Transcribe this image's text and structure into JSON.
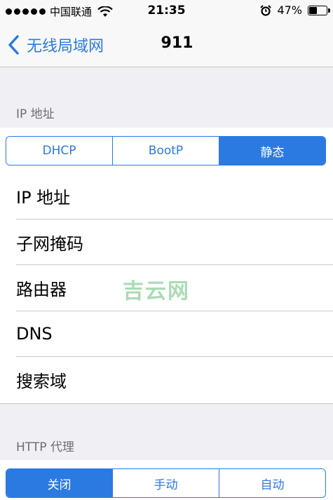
{
  "status_bar": {
    "carrier": "中国联通",
    "time": "21:35",
    "battery_percent": "47%",
    "battery_level": 0.47
  },
  "nav": {
    "back_label": "无线局域网",
    "title": "911"
  },
  "ip_section": {
    "header": "IP 地址",
    "segments": [
      {
        "label": "DHCP",
        "active": false
      },
      {
        "label": "BootP",
        "active": false
      },
      {
        "label": "静态",
        "active": true
      }
    ]
  },
  "static_fields": [
    {
      "label": "IP 地址"
    },
    {
      "label": "子网掩码"
    },
    {
      "label": "路由器"
    },
    {
      "label": "DNS"
    },
    {
      "label": "搜索域"
    }
  ],
  "http_proxy_section": {
    "header": "HTTP 代理",
    "segments": [
      {
        "label": "关闭",
        "active": true
      },
      {
        "label": "手动",
        "active": false
      },
      {
        "label": "自动",
        "active": false
      }
    ]
  },
  "watermark": "吉云网",
  "colors": {
    "accent": "#2a7ae2",
    "background": "#efeff4",
    "separator": "#c8c7cc",
    "section_text": "#6d6d72"
  }
}
